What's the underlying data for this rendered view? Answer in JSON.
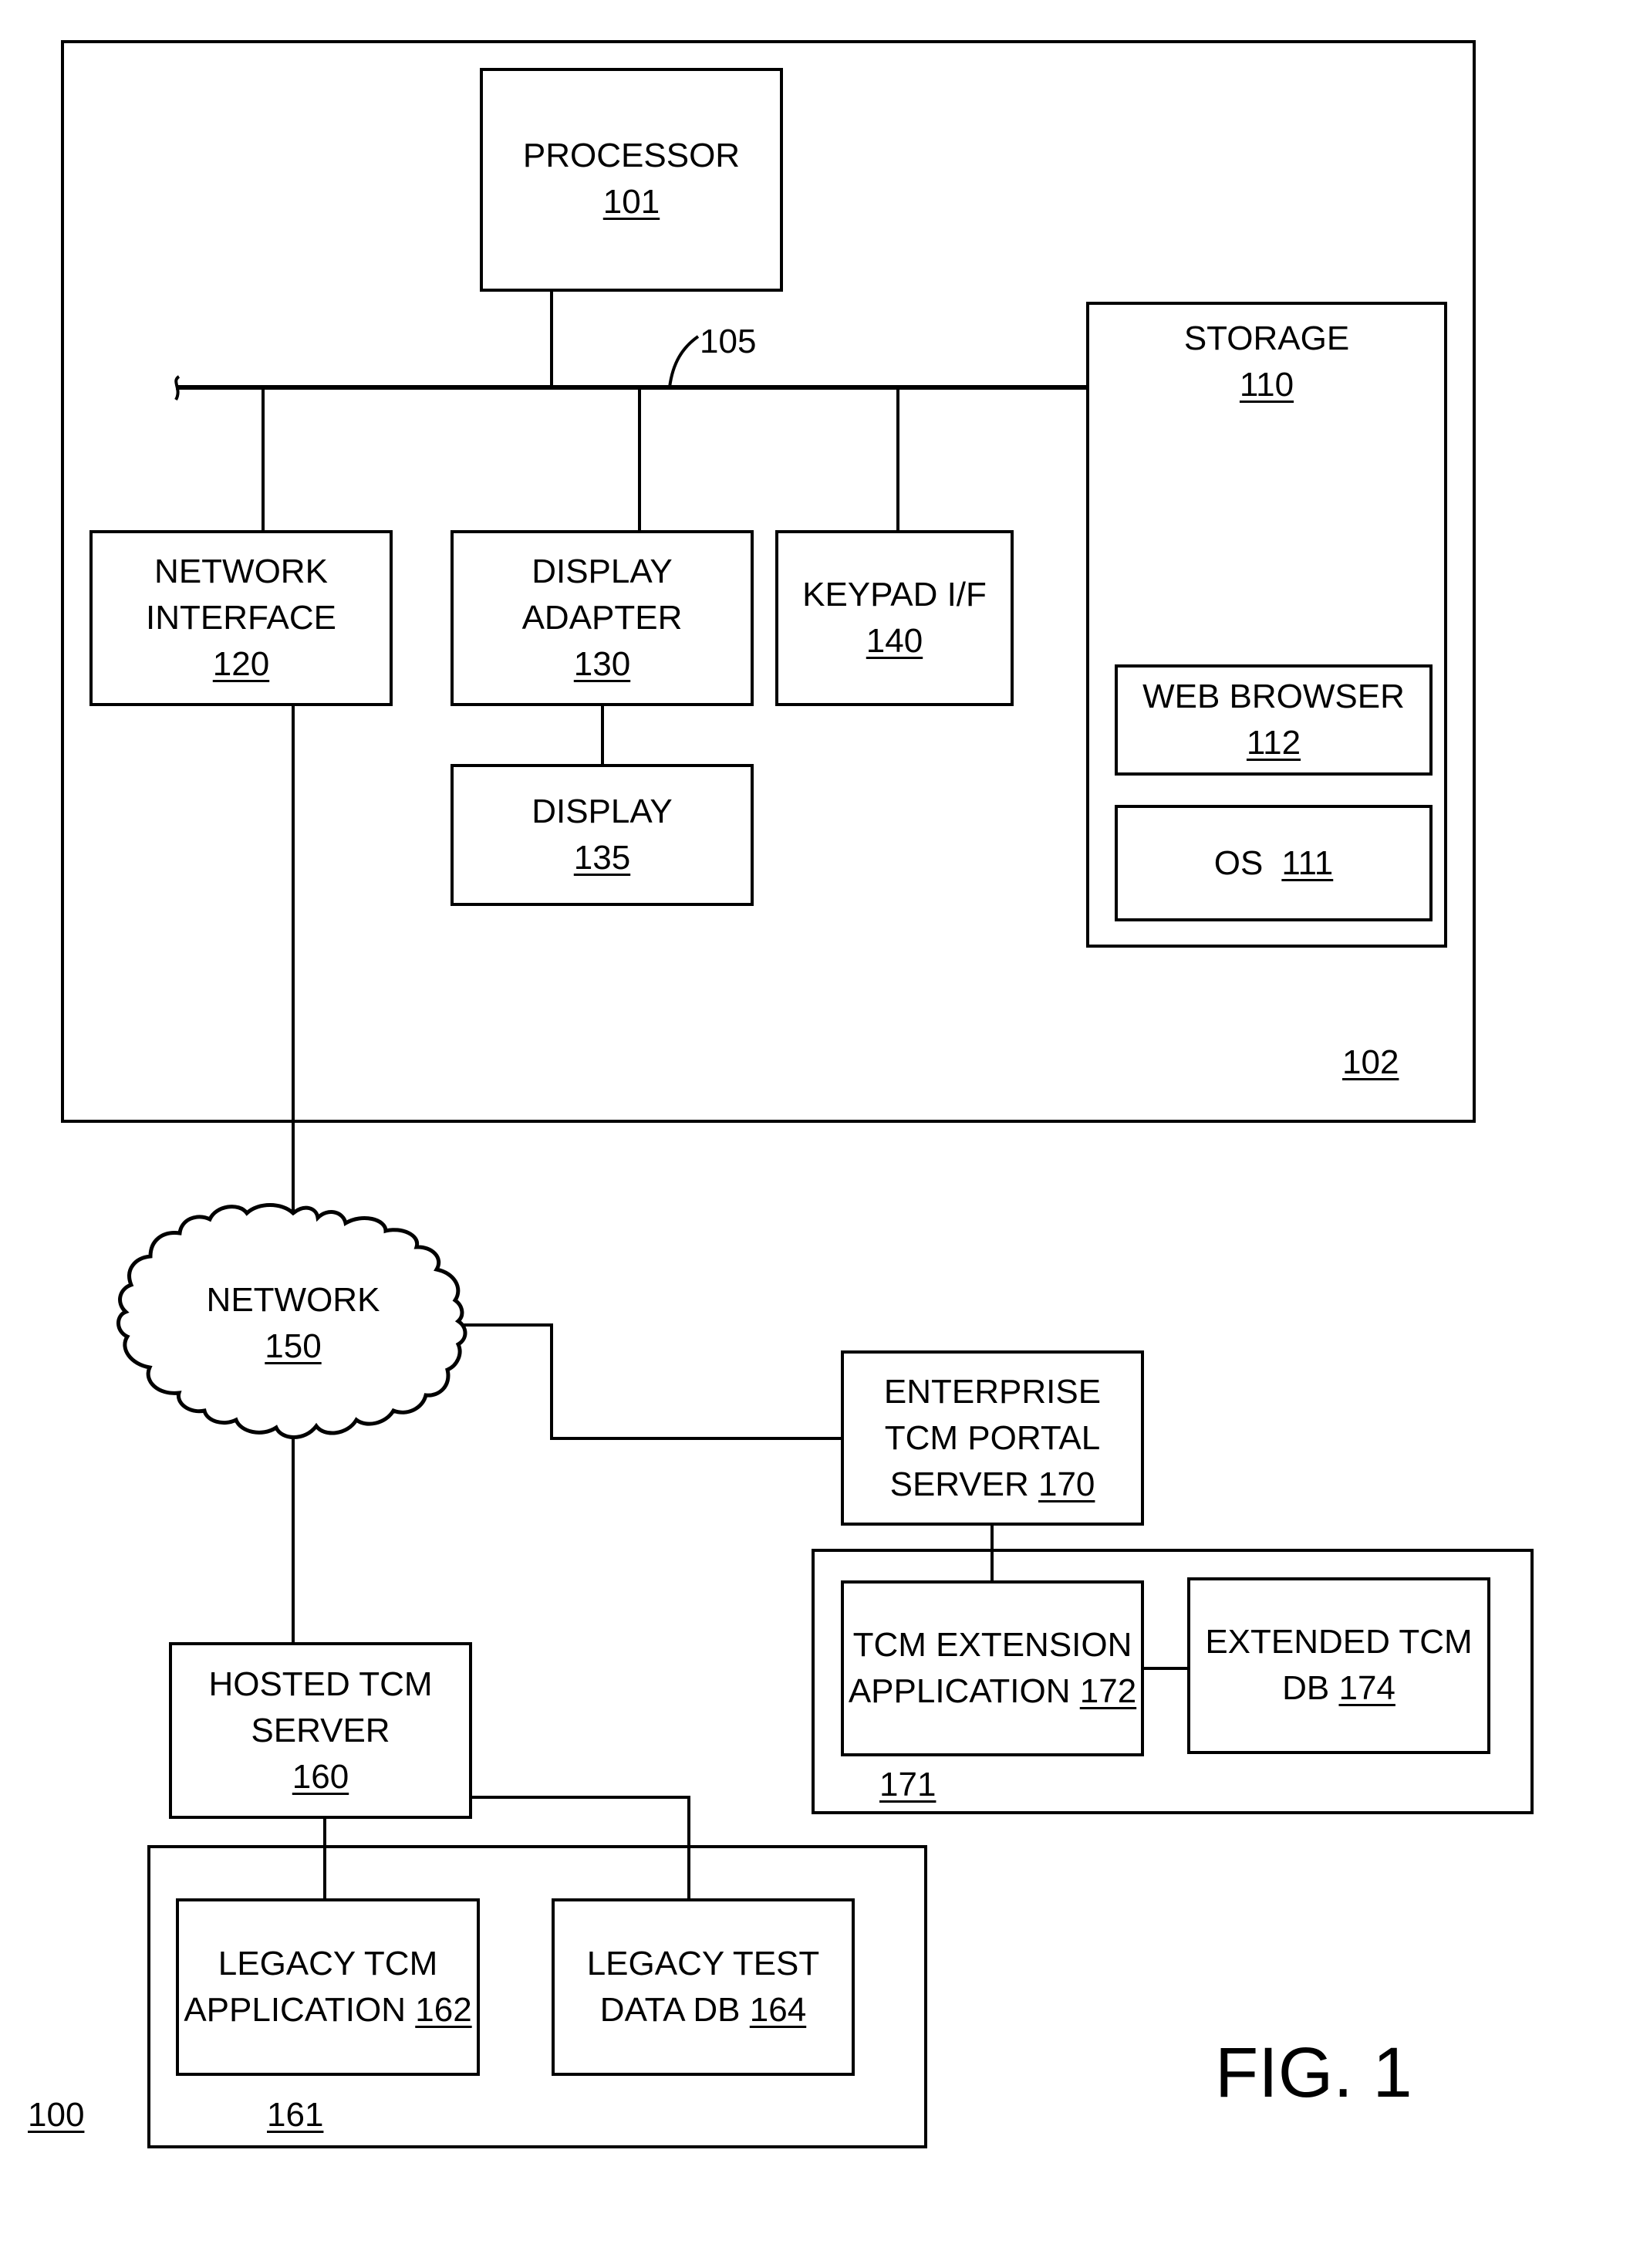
{
  "figure": {
    "title": "FIG. 1",
    "system_ref": "100"
  },
  "computer": {
    "ref": "102",
    "bus_ref": "105",
    "processor": {
      "label": "PROCESSOR",
      "ref": "101"
    },
    "storage": {
      "label": "STORAGE",
      "ref": "110"
    },
    "web_browser": {
      "label": "WEB BROWSER",
      "ref": "112"
    },
    "os": {
      "label": "OS",
      "ref": "111"
    },
    "network_interface": {
      "line1": "NETWORK",
      "line2": "INTERFACE",
      "ref": "120"
    },
    "display_adapter": {
      "line1": "DISPLAY",
      "line2": "ADAPTER",
      "ref": "130"
    },
    "display": {
      "label": "DISPLAY",
      "ref": "135"
    },
    "keypad": {
      "label": "KEYPAD I/F",
      "ref": "140"
    }
  },
  "network": {
    "label": "NETWORK",
    "ref": "150"
  },
  "enterprise": {
    "portal": {
      "line1": "ENTERPRISE",
      "line2": "TCM PORTAL",
      "line3": "SERVER",
      "ref": "170"
    },
    "group_ref": "171",
    "extension_app": {
      "line1": "TCM EXTENSION",
      "line2": "APPLICATION",
      "ref": "172"
    },
    "extended_db": {
      "line1": "EXTENDED TCM",
      "line2": "DB",
      "ref": "174"
    }
  },
  "hosted": {
    "server": {
      "line1": "HOSTED TCM",
      "line2": "SERVER",
      "ref": "160"
    },
    "group_ref": "161",
    "legacy_app": {
      "line1": "LEGACY TCM",
      "line2": "APPLICATION",
      "ref": "162"
    },
    "legacy_db": {
      "line1": "LEGACY TEST",
      "line2": "DATA DB",
      "ref": "164"
    }
  }
}
